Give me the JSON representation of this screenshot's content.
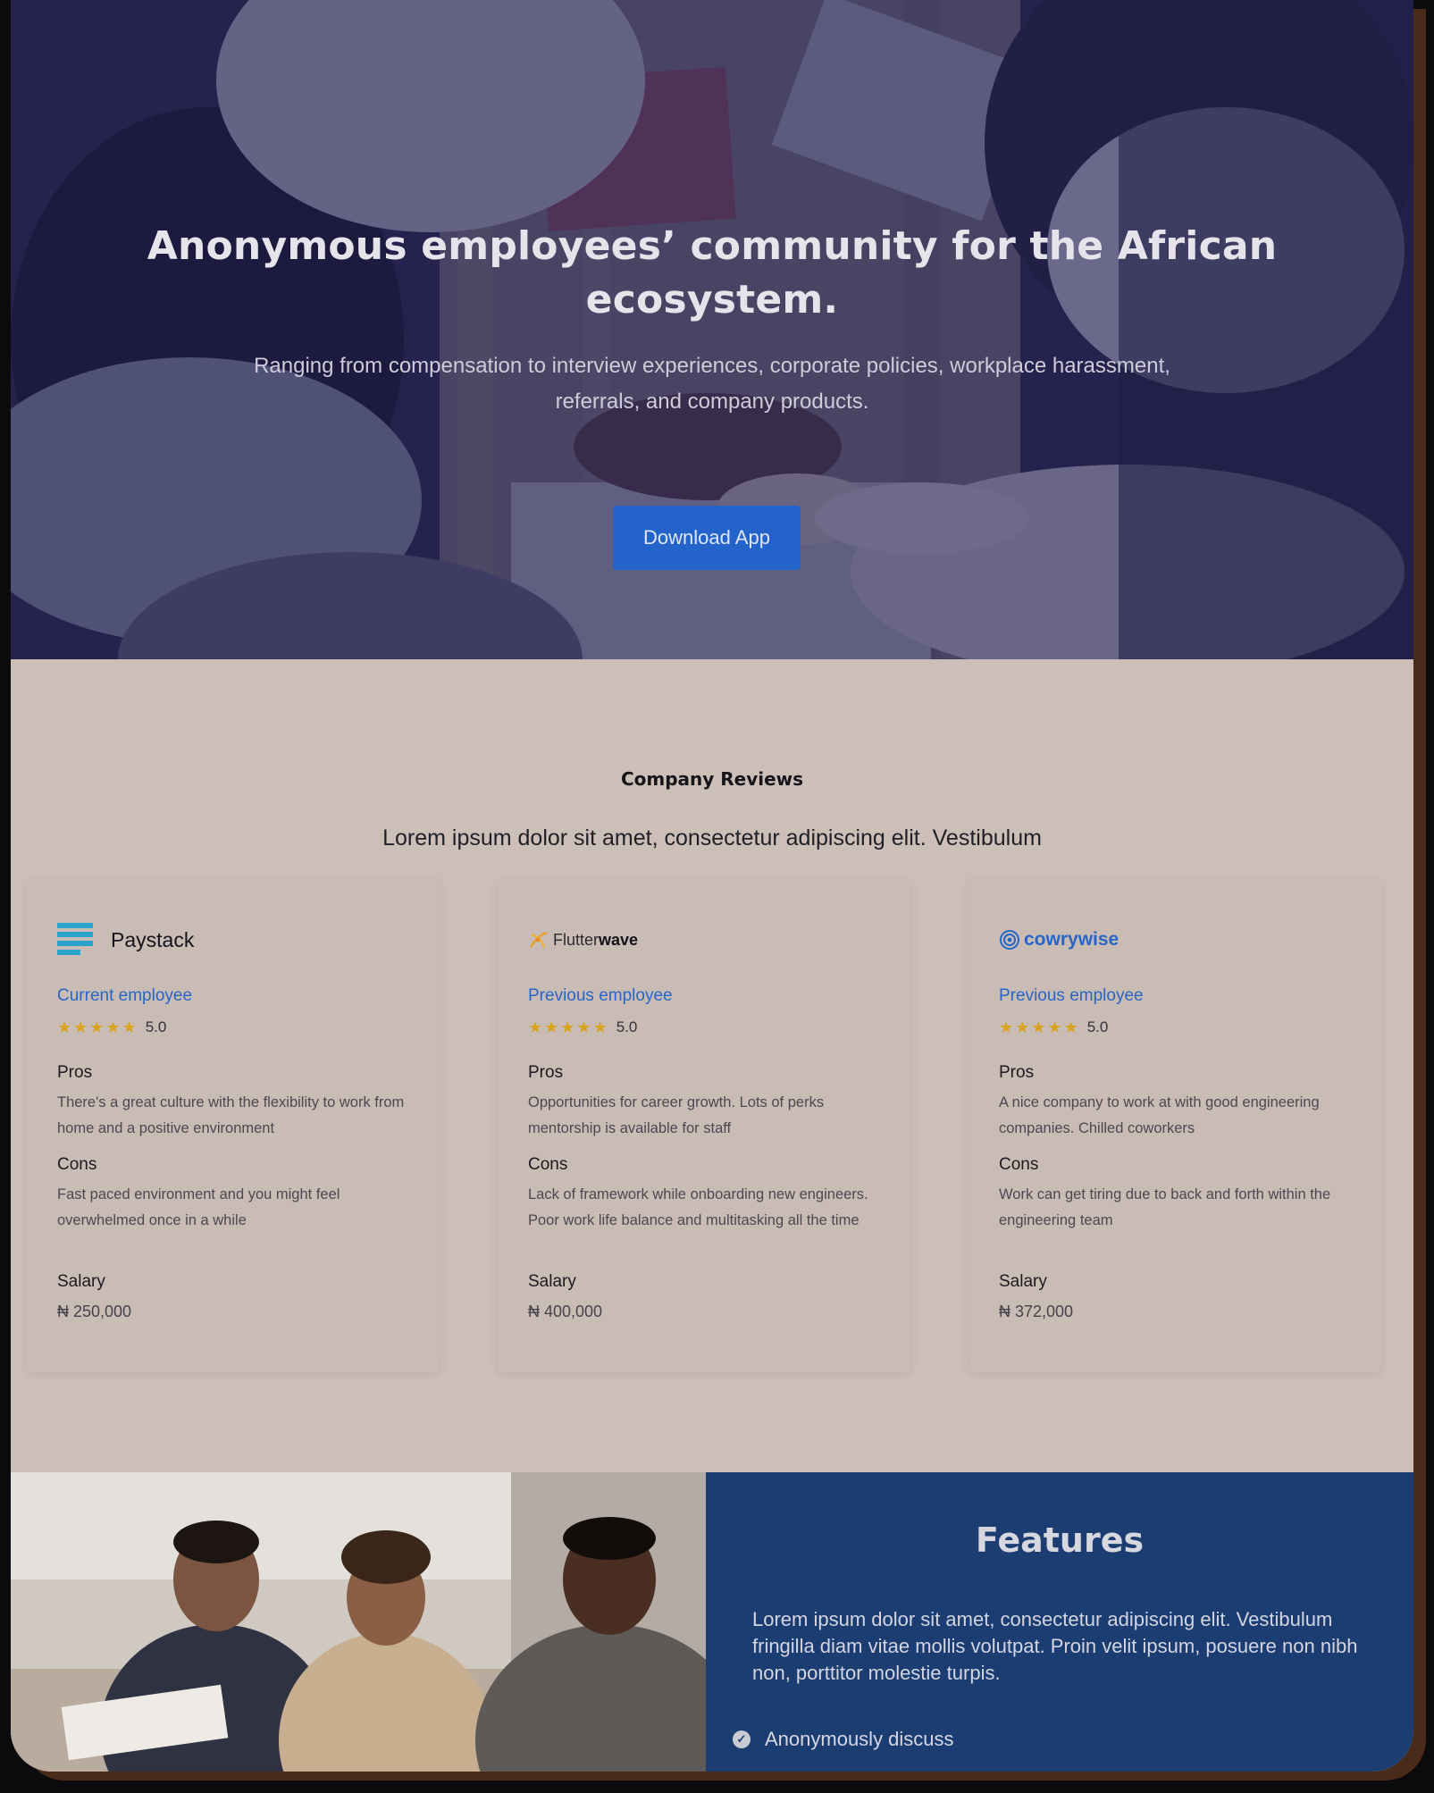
{
  "hero": {
    "title": "Anonymous employees’ community for the African ecosystem.",
    "subtitle": "Ranging from compensation to interview experiences, corporate policies, workplace harassment, referrals, and company products.",
    "cta_label": "Download App"
  },
  "reviews": {
    "title": "Company Reviews",
    "subtitle": "Lorem ipsum dolor sit amet, consectetur adipiscing elit. Vestibulum",
    "pros_label": "Pros",
    "cons_label": "Cons",
    "salary_label": "Salary",
    "cards": [
      {
        "company": "Paystack",
        "logo_icon": "paystack-logo-icon",
        "role": "Current employee",
        "rating": "5.0",
        "pros": "There's a great culture with the flexibility to work from home and a positive environment",
        "cons": "Fast paced environment and you might feel overwhelmed once in a while",
        "salary": "₦ 250,000"
      },
      {
        "company_part1": "Flutter",
        "company_part2": "wave",
        "logo_icon": "flutterwave-logo-icon",
        "role": "Previous employee",
        "rating": "5.0",
        "pros": "Opportunities for career growth. Lots of perks mentorship is available for staff",
        "cons": "Lack of framework while onboarding new engineers. Poor work life balance and multitasking all the time",
        "salary": "₦ 400,000"
      },
      {
        "company": "cowrywise",
        "logo_icon": "cowrywise-logo-icon",
        "role": "Previous employee",
        "rating": "5.0",
        "pros": "A nice company to work at with good engineering companies. Chilled coworkers",
        "cons": "Work can get tiring due to back and forth within the engineering team",
        "salary": "₦ 372,000"
      }
    ]
  },
  "features": {
    "title": "Features",
    "text": "Lorem ipsum dolor sit amet, consectetur adipiscing elit. Vestibulum fringilla diam vitae mollis volutpat. Proin velit ipsum, posuere non nibh non, porttitor molestie turpis.",
    "items": [
      "Anonymously discuss"
    ]
  },
  "colors": {
    "accent": "#2463c9",
    "role_link": "#2865c6",
    "star": "#d9a21f",
    "features_bg": "#1b3d72",
    "page_bg": "#cbbfb8"
  }
}
